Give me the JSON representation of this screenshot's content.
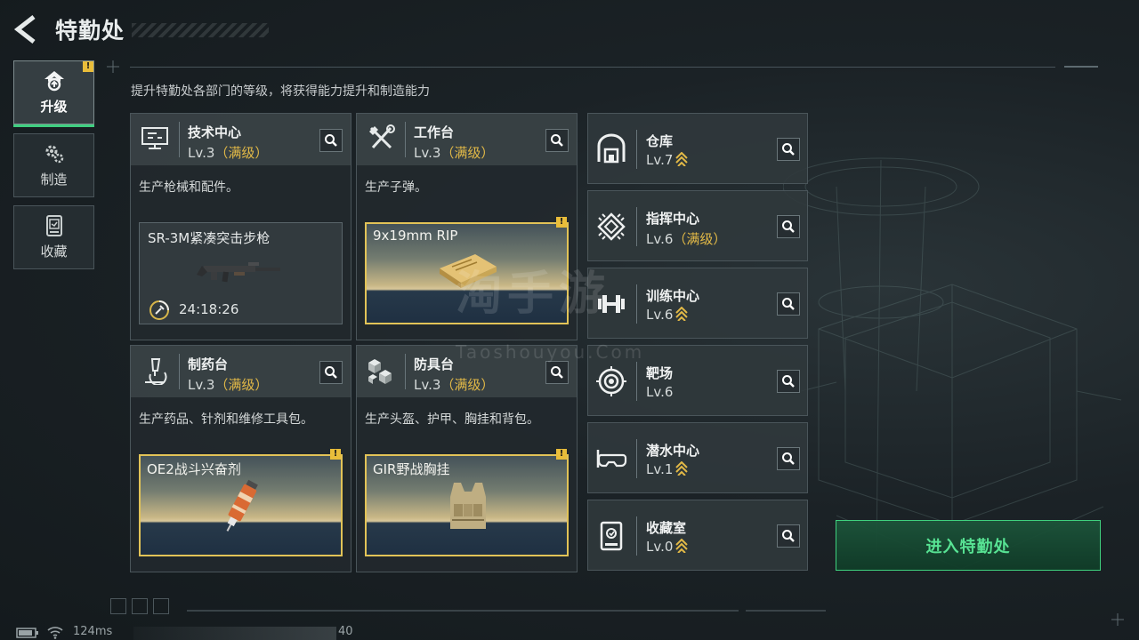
{
  "header": {
    "title": "特勤处",
    "subtitle": "提升特勤处各部门的等级，将获得能力提升和制造能力"
  },
  "nav": [
    {
      "label": "升级",
      "icon": "upgrade-icon",
      "active": true,
      "warning": "!"
    },
    {
      "label": "制造",
      "icon": "gears-icon",
      "active": false
    },
    {
      "label": "收藏",
      "icon": "collection-icon",
      "active": false
    }
  ],
  "departments": [
    {
      "name": "技术中心",
      "level": "Lv.3",
      "max": "（满级）",
      "desc": "生产枪械和配件。",
      "product": {
        "name": "SR-3M紧凑突击步枪",
        "timer": "24:18:26"
      }
    },
    {
      "name": "工作台",
      "level": "Lv.3",
      "max": "（满级）",
      "desc": "生产子弹。",
      "product": {
        "name": "9x19mm RIP",
        "warning": "!"
      }
    },
    {
      "name": "制药台",
      "level": "Lv.3",
      "max": "（满级）",
      "desc": "生产药品、针剂和维修工具包。",
      "product": {
        "name": "OE2战斗兴奋剂",
        "warning": "!"
      }
    },
    {
      "name": "防具台",
      "level": "Lv.3",
      "max": "（满级）",
      "desc": "生产头盔、护甲、胸挂和背包。",
      "product": {
        "name": "GIR野战胸挂",
        "warning": "!"
      }
    }
  ],
  "facilities": [
    {
      "name": "仓库",
      "level": "Lv.7",
      "max": "",
      "upgradable": true,
      "icon": "warehouse-icon"
    },
    {
      "name": "指挥中心",
      "level": "Lv.6",
      "max": "（满级）",
      "upgradable": false,
      "icon": "chip-icon"
    },
    {
      "name": "训练中心",
      "level": "Lv.6",
      "max": "",
      "upgradable": true,
      "icon": "dumbbell-icon"
    },
    {
      "name": "靶场",
      "level": "Lv.6",
      "max": "",
      "upgradable": false,
      "icon": "target-icon"
    },
    {
      "name": "潜水中心",
      "level": "Lv.1",
      "max": "",
      "upgradable": true,
      "icon": "diving-mask-icon"
    },
    {
      "name": "收藏室",
      "level": "Lv.0",
      "max": "",
      "upgradable": true,
      "icon": "collection-room-icon"
    }
  ],
  "enter_button": "进入特勤处",
  "watermark": {
    "title": "淘手游",
    "url": "Taoshouyou.Com"
  },
  "status": {
    "ping": "124ms",
    "fps": "40"
  },
  "colors": {
    "accent_green": "#3fd17e",
    "max_gold": "#e2b947",
    "warning_yellow": "#e9bd3a"
  }
}
